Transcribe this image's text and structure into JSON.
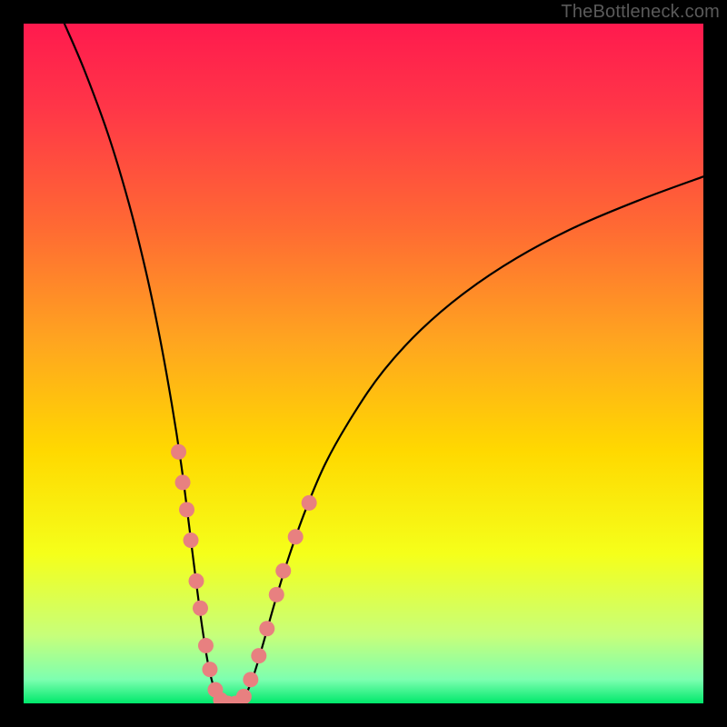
{
  "watermark": "TheBottleneck.com",
  "colors": {
    "background": "#000000",
    "gradient_stops": [
      {
        "offset": 0.0,
        "color": "#ff1a4e"
      },
      {
        "offset": 0.12,
        "color": "#ff3548"
      },
      {
        "offset": 0.3,
        "color": "#ff6a33"
      },
      {
        "offset": 0.47,
        "color": "#ffa61f"
      },
      {
        "offset": 0.63,
        "color": "#ffd900"
      },
      {
        "offset": 0.78,
        "color": "#f5ff1a"
      },
      {
        "offset": 0.9,
        "color": "#c7ff7a"
      },
      {
        "offset": 0.965,
        "color": "#7dffb0"
      },
      {
        "offset": 1.0,
        "color": "#00e86b"
      }
    ],
    "curve_stroke": "#000000",
    "marker_fill": "#e88080",
    "watermark_text": "#5a5a5a"
  },
  "chart_data": {
    "type": "line",
    "title": "",
    "xlabel": "",
    "ylabel": "",
    "xlim": [
      0,
      100
    ],
    "ylim": [
      0,
      100
    ],
    "curve_points": [
      {
        "x": 6.0,
        "y": 100.0
      },
      {
        "x": 9.0,
        "y": 93.0
      },
      {
        "x": 12.5,
        "y": 83.5
      },
      {
        "x": 15.5,
        "y": 73.5
      },
      {
        "x": 18.0,
        "y": 63.5
      },
      {
        "x": 20.0,
        "y": 54.0
      },
      {
        "x": 21.8,
        "y": 44.0
      },
      {
        "x": 23.2,
        "y": 35.0
      },
      {
        "x": 24.3,
        "y": 26.5
      },
      {
        "x": 25.3,
        "y": 18.5
      },
      {
        "x": 26.3,
        "y": 11.0
      },
      {
        "x": 27.3,
        "y": 5.0
      },
      {
        "x": 28.5,
        "y": 1.0
      },
      {
        "x": 29.8,
        "y": 0.0
      },
      {
        "x": 31.2,
        "y": 0.0
      },
      {
        "x": 32.5,
        "y": 1.0
      },
      {
        "x": 33.8,
        "y": 4.0
      },
      {
        "x": 35.3,
        "y": 9.0
      },
      {
        "x": 37.0,
        "y": 15.0
      },
      {
        "x": 39.0,
        "y": 21.5
      },
      {
        "x": 41.5,
        "y": 28.5
      },
      {
        "x": 44.5,
        "y": 35.5
      },
      {
        "x": 48.5,
        "y": 42.5
      },
      {
        "x": 53.0,
        "y": 49.0
      },
      {
        "x": 58.5,
        "y": 55.0
      },
      {
        "x": 65.0,
        "y": 60.5
      },
      {
        "x": 72.5,
        "y": 65.5
      },
      {
        "x": 81.0,
        "y": 70.0
      },
      {
        "x": 90.5,
        "y": 74.0
      },
      {
        "x": 100.0,
        "y": 77.5
      }
    ],
    "markers": [
      {
        "x": 22.8,
        "y": 37.0
      },
      {
        "x": 23.4,
        "y": 32.5
      },
      {
        "x": 24.0,
        "y": 28.5
      },
      {
        "x": 24.6,
        "y": 24.0
      },
      {
        "x": 25.4,
        "y": 18.0
      },
      {
        "x": 26.0,
        "y": 14.0
      },
      {
        "x": 26.8,
        "y": 8.5
      },
      {
        "x": 27.4,
        "y": 5.0
      },
      {
        "x": 28.2,
        "y": 2.0
      },
      {
        "x": 29.0,
        "y": 0.5
      },
      {
        "x": 30.0,
        "y": 0.0
      },
      {
        "x": 31.2,
        "y": 0.0
      },
      {
        "x": 32.4,
        "y": 1.0
      },
      {
        "x": 33.4,
        "y": 3.5
      },
      {
        "x": 34.6,
        "y": 7.0
      },
      {
        "x": 35.8,
        "y": 11.0
      },
      {
        "x": 37.2,
        "y": 16.0
      },
      {
        "x": 38.2,
        "y": 19.5
      },
      {
        "x": 40.0,
        "y": 24.5
      },
      {
        "x": 42.0,
        "y": 29.5
      }
    ]
  }
}
